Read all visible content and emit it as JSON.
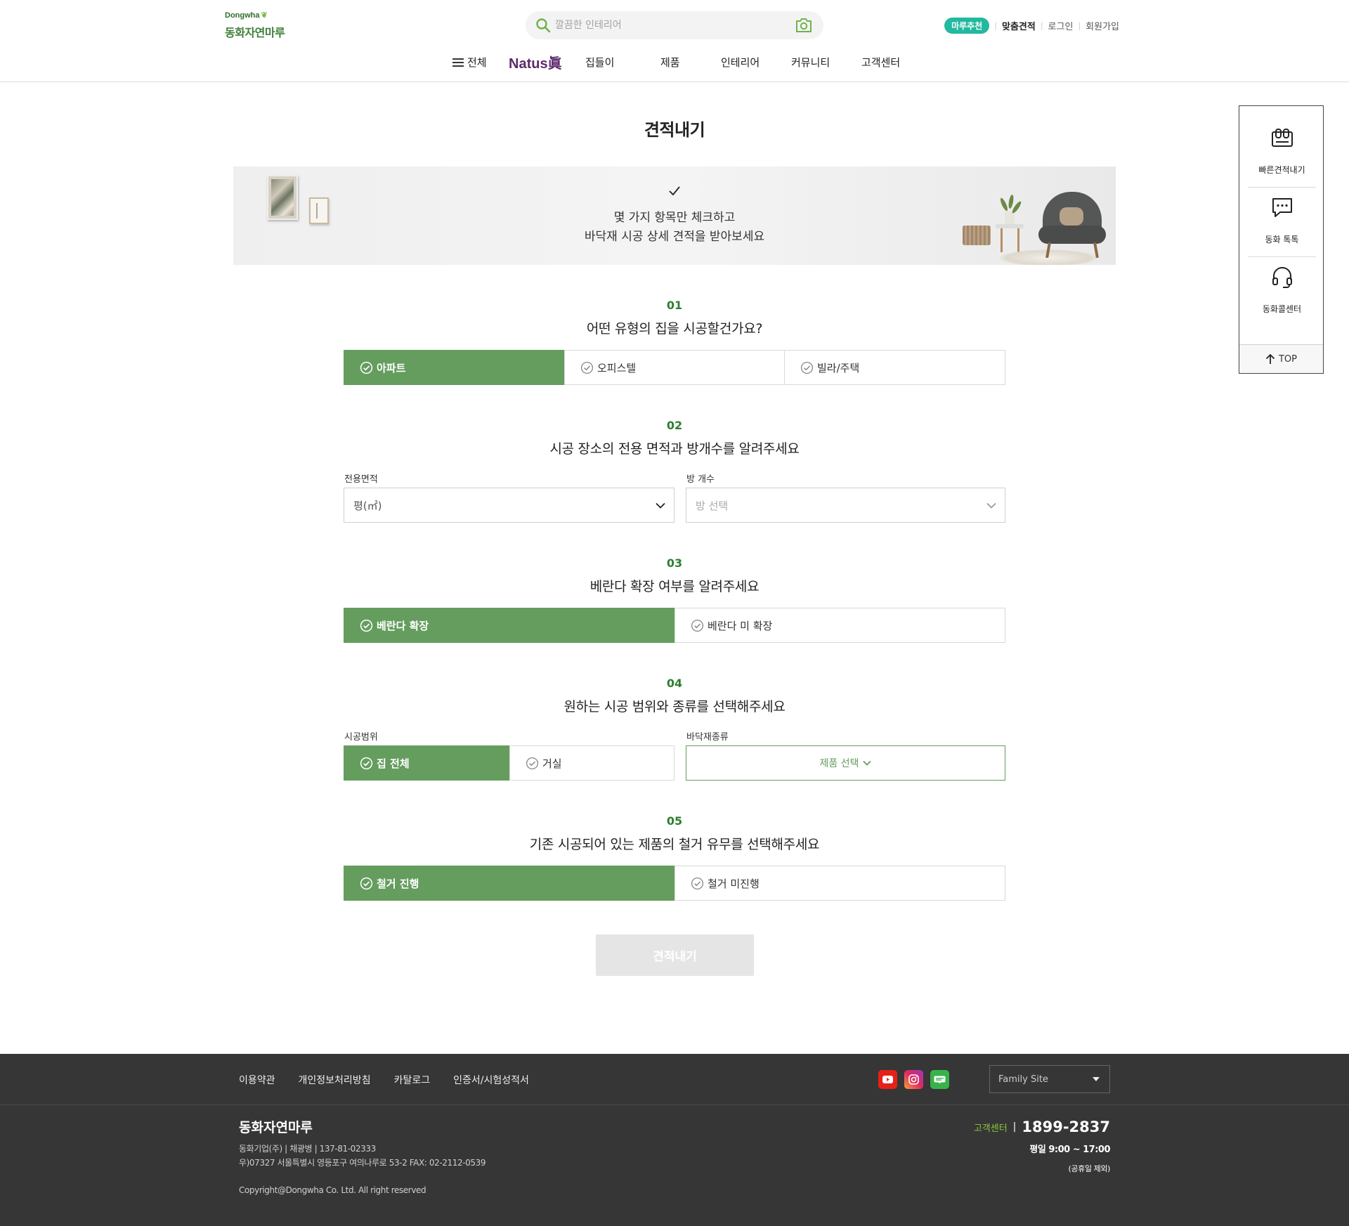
{
  "header": {
    "logo_en": "Dongwha",
    "logo_ko": "동화자연마루",
    "search_placeholder": "깔끔한 인테리어",
    "util": {
      "badge": "마루추천",
      "custom_quote": "맞춤견적",
      "login": "로그인",
      "signup": "회원가입"
    },
    "nav": {
      "all": "전체",
      "natus": "Natus眞",
      "housewarming": "집들이",
      "products": "제품",
      "interior": "인테리어",
      "community": "커뮤니티",
      "cs": "고객센터"
    }
  },
  "page": {
    "title": "견적내기",
    "banner_line1": "몇 가지 항목만 체크하고",
    "banner_line2": "바닥재 시공 상세 견적을 받아보세요"
  },
  "steps": {
    "s1": {
      "no": "01",
      "question": "어떤 유형의 집을 시공할건가요?",
      "options": [
        "아파트",
        "오피스텔",
        "빌라/주택"
      ],
      "selected": "아파트"
    },
    "s2": {
      "no": "02",
      "question": "시공 장소의 전용 면적과 방개수를 알려주세요",
      "area_label": "전용면적",
      "area_value": "평(㎡)",
      "rooms_label": "방 개수",
      "rooms_value": "방 선택"
    },
    "s3": {
      "no": "03",
      "question": "베란다 확장 여부를 알려주세요",
      "options": [
        "베란다 확장",
        "베란다 미 확장"
      ],
      "selected": "베란다 확장"
    },
    "s4": {
      "no": "04",
      "question": "원하는 시공 범위와 종류를 선택해주세요",
      "scope_label": "시공범위",
      "scope_options": [
        "집 전체",
        "거실"
      ],
      "selected": "집 전체",
      "floor_label": "바닥재종류",
      "floor_value": "제품 선택"
    },
    "s5": {
      "no": "05",
      "question": "기존 시공되어 있는 제품의 철거 유무를 선택해주세요",
      "options": [
        "철거 진행",
        "철거 미진행"
      ],
      "selected": "철거 진행"
    }
  },
  "submit_label": "견적내기",
  "quick_menu": {
    "quote": "빠른견적내기",
    "talk": "동화 톡톡",
    "call": "동화콜센터",
    "top": "TOP"
  },
  "footer": {
    "links": [
      "이용약관",
      "개인정보처리방침",
      "카탈로그",
      "인증서/시험성적서"
    ],
    "family_site": "Family Site",
    "brand": "동화자연마루",
    "company": "동화기업(주) | 채광병 | 137-81-02333",
    "address": "우)07327 서울특별시 영등포구 여의나루로 53-2     FAX: 02-2112-0539",
    "copyright": "Copyright@Dongwha Co. Ltd. All right reserved",
    "cs_label": "고객센터",
    "cs_tel": "1899-2837",
    "cs_hours": "평일 9:00 ~ 17:00",
    "cs_holiday": "(공휴일 제외)"
  },
  "colors": {
    "brand_green": "#649d5e",
    "badge_teal": "#22b9a0",
    "footer_bg": "#363636",
    "natus_purple": "#5c2a6e"
  }
}
